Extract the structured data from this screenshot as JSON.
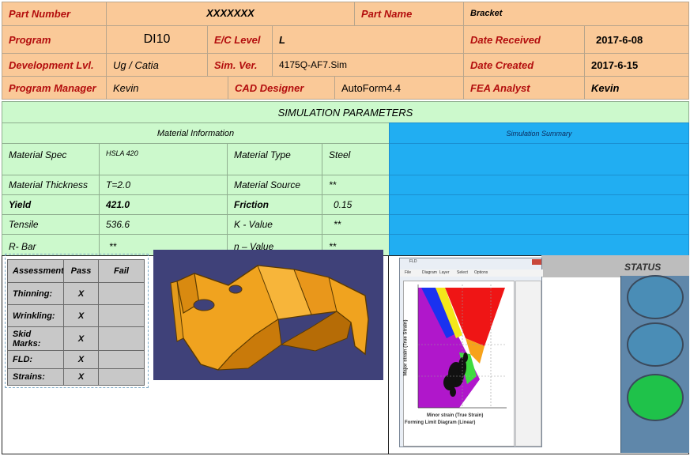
{
  "header": {
    "part_number_label": "Part Number",
    "part_number": "XXXXXXX",
    "part_name_label": "Part Name",
    "part_name": "Bracket",
    "program_label": "Program",
    "program": "DI10",
    "ec_level_label": "E/C Level",
    "ec_level": "L",
    "date_received_label": "Date Received",
    "date_received": "2017-6-08",
    "dev_lvl_label": "Development Lvl.",
    "dev_lvl": "Ug / Catia",
    "sim_ver_label": "Sim. Ver.",
    "sim_ver": "4175Q-AF7.Sim",
    "date_created_label": "Date Created",
    "date_created": "2017-6-15",
    "pm_label": "Program Manager",
    "pm": "Kevin",
    "cad_label": "CAD Designer",
    "cad": "AutoForm4.4",
    "fea_label": "FEA Analyst",
    "fea": "Kevin"
  },
  "params": {
    "title": "SIMULATION PARAMETERS",
    "material_info": "Material Information",
    "sim_summary": "Simulation Summary",
    "spec_label": "Material Spec",
    "spec": "HSLA 420",
    "type_label": "Material Type",
    "type": "Steel",
    "thickness_label": "Material Thickness",
    "thickness": "T=2.0",
    "source_label": "Material Source",
    "source": "**",
    "yield_label": "Yield",
    "yield": "421.0",
    "friction_label": "Friction",
    "friction": "0.15",
    "tensile_label": "Tensile",
    "tensile": "536.6",
    "k_label": "K - Value",
    "k": "**",
    "rbar_label": "R- Bar",
    "rbar": "**",
    "n_label": "n – Value",
    "n": "**"
  },
  "assessment": {
    "headers": [
      "Assessment",
      "Pass",
      "Fail"
    ],
    "rows": [
      {
        "name": "Thinning:",
        "pass": "X",
        "fail": ""
      },
      {
        "name": "Wrinkling:",
        "pass": "X",
        "fail": ""
      },
      {
        "name": "Skid Marks:",
        "pass": "X",
        "fail": ""
      },
      {
        "name": "FLD:",
        "pass": "X",
        "fail": ""
      },
      {
        "name": "Strains:",
        "pass": "X",
        "fail": ""
      }
    ]
  },
  "status": {
    "title": "STATUS",
    "lights": [
      "#4a8db6",
      "#4a8db6",
      "#1fc24a"
    ]
  },
  "fld": {
    "window_title": "FLD",
    "menu": [
      "File",
      "Diagram",
      "Layer",
      "Select",
      "Options"
    ],
    "xlabel": "Minor strain (True Strain)",
    "ylabel": "Major strain (True Strain)",
    "caption": "Forming Limit Diagram (Linear)"
  }
}
